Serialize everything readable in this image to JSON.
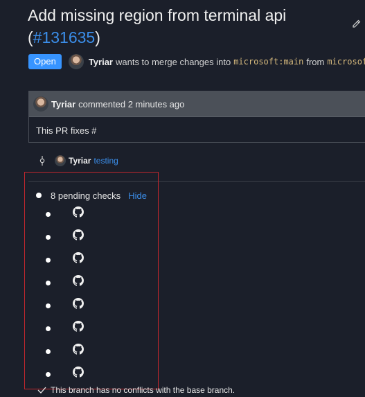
{
  "pr": {
    "title": "Add missing region from terminal api",
    "paren_open": "(",
    "number": "#131635",
    "paren_close": ")",
    "status_badge": "Open",
    "author": "Tyriar",
    "merge_text": "wants to merge changes into",
    "target_branch": "microsoft:main",
    "from_text": "from",
    "source_branch": "microsoft"
  },
  "comment": {
    "author": "Tyriar",
    "meta": "commented 2 minutes ago",
    "body": "This PR fixes #"
  },
  "commit": {
    "author": "Tyriar",
    "message": "testing"
  },
  "checks": {
    "summary": "8 pending checks",
    "toggle_label": "Hide",
    "items": [
      {
        "icon": "github-icon"
      },
      {
        "icon": "github-icon"
      },
      {
        "icon": "github-icon"
      },
      {
        "icon": "github-icon"
      },
      {
        "icon": "github-icon"
      },
      {
        "icon": "github-icon"
      },
      {
        "icon": "github-icon"
      },
      {
        "icon": "github-icon"
      }
    ]
  },
  "branch_status": "This branch has no conflicts with the base branch.",
  "colors": {
    "background": "#1b1f2a",
    "accent": "#3794ff",
    "link": "#3b8eea",
    "highlight_border": "#c3272d"
  }
}
